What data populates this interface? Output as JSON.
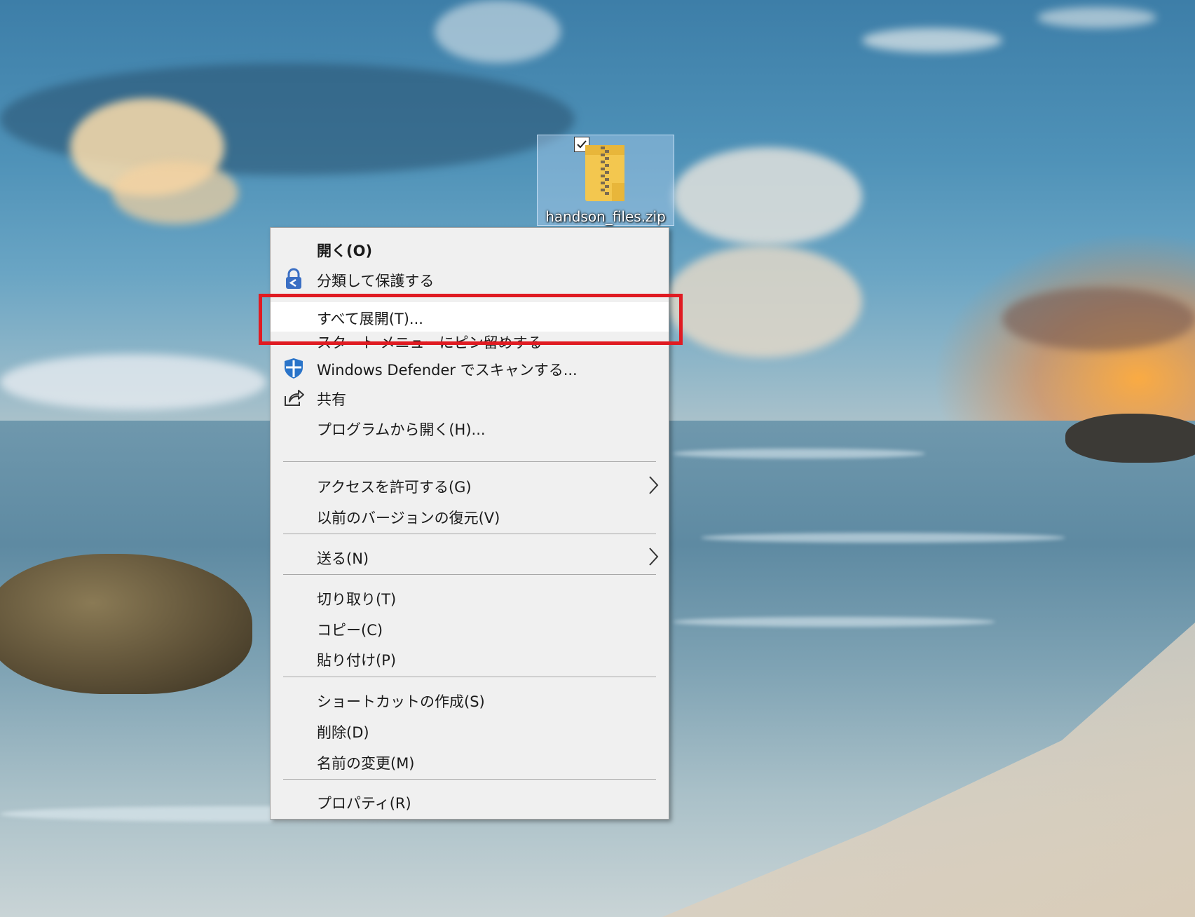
{
  "desktop": {
    "icon": {
      "filename": "handson_files.zip",
      "selected": true,
      "icon": "zip-folder-icon"
    }
  },
  "context_menu": {
    "items": [
      {
        "label": "開く(O)",
        "bold": true
      },
      {
        "label": "分類して保護する",
        "icon": "lock-shield-icon"
      },
      {
        "label": "すべて展開(T)...",
        "highlighted": true
      },
      {
        "label": "スタート メニューにピン留めする"
      },
      {
        "label": "Windows Defender でスキャンする...",
        "icon": "defender-shield-icon"
      },
      {
        "label": "共有",
        "icon": "share-icon"
      },
      {
        "label": "プログラムから開く(H)..."
      },
      {
        "label": "アクセスを許可する(G)",
        "submenu": true
      },
      {
        "label": "以前のバージョンの復元(V)"
      },
      {
        "label": "送る(N)",
        "submenu": true
      },
      {
        "label": "切り取り(T)"
      },
      {
        "label": "コピー(C)"
      },
      {
        "label": "貼り付け(P)"
      },
      {
        "label": "ショートカットの作成(S)"
      },
      {
        "label": "削除(D)"
      },
      {
        "label": "名前の変更(M)"
      },
      {
        "label": "プロパティ(R)"
      }
    ]
  },
  "annotation": {
    "color": "#e01b22",
    "target": "すべて展開(T)..."
  }
}
